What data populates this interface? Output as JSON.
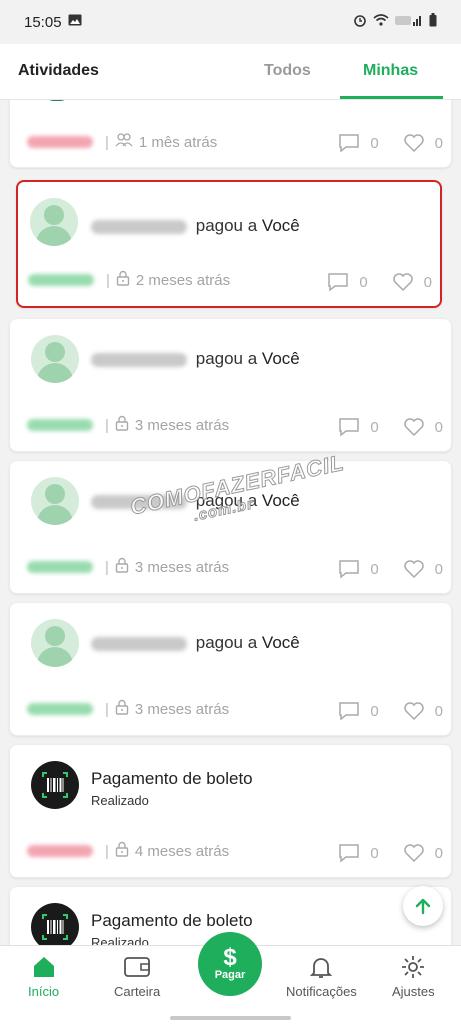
{
  "status_bar": {
    "time": "15:05"
  },
  "header": {
    "title": "Atividades",
    "tabs": [
      {
        "label": "Todos",
        "active": false
      },
      {
        "label": "Minhas",
        "active": true
      }
    ]
  },
  "feed": {
    "items": [
      {
        "type": "payment-partial",
        "privacy": "friends",
        "time": "1 mês atrás",
        "comments": "0",
        "likes": "0"
      },
      {
        "type": "payment",
        "verb": "pagou a",
        "target": "Você",
        "privacy": "private",
        "time": "2 meses atrás",
        "comments": "0",
        "likes": "0",
        "highlighted": true
      },
      {
        "type": "payment",
        "verb": "pagou a",
        "target": "Você",
        "privacy": "private",
        "time": "3 meses atrás",
        "comments": "0",
        "likes": "0"
      },
      {
        "type": "payment",
        "verb": "pagou a",
        "target": "Você",
        "privacy": "private",
        "time": "3 meses atrás",
        "comments": "0",
        "likes": "0"
      },
      {
        "type": "payment",
        "verb": "pagou a",
        "target": "Você",
        "privacy": "private",
        "time": "3 meses atrás",
        "comments": "0",
        "likes": "0"
      },
      {
        "type": "boleto",
        "title": "Pagamento de boleto",
        "subtitle": "Realizado",
        "privacy": "private",
        "time": "4 meses atrás",
        "comments": "0",
        "likes": "0"
      },
      {
        "type": "boleto",
        "title": "Pagamento de boleto",
        "subtitle": "Realizado"
      }
    ]
  },
  "watermark": {
    "line1": "COMOFAZERFACIL",
    "line2": ".com.br"
  },
  "bottom_nav": {
    "items": [
      {
        "label": "Início",
        "active": true
      },
      {
        "label": "Carteira"
      },
      {
        "label": "Pagar"
      },
      {
        "label": "Notificações"
      },
      {
        "label": "Ajustes"
      }
    ]
  },
  "colors": {
    "accent": "#1fae5b",
    "highlight_border": "#d32424"
  }
}
